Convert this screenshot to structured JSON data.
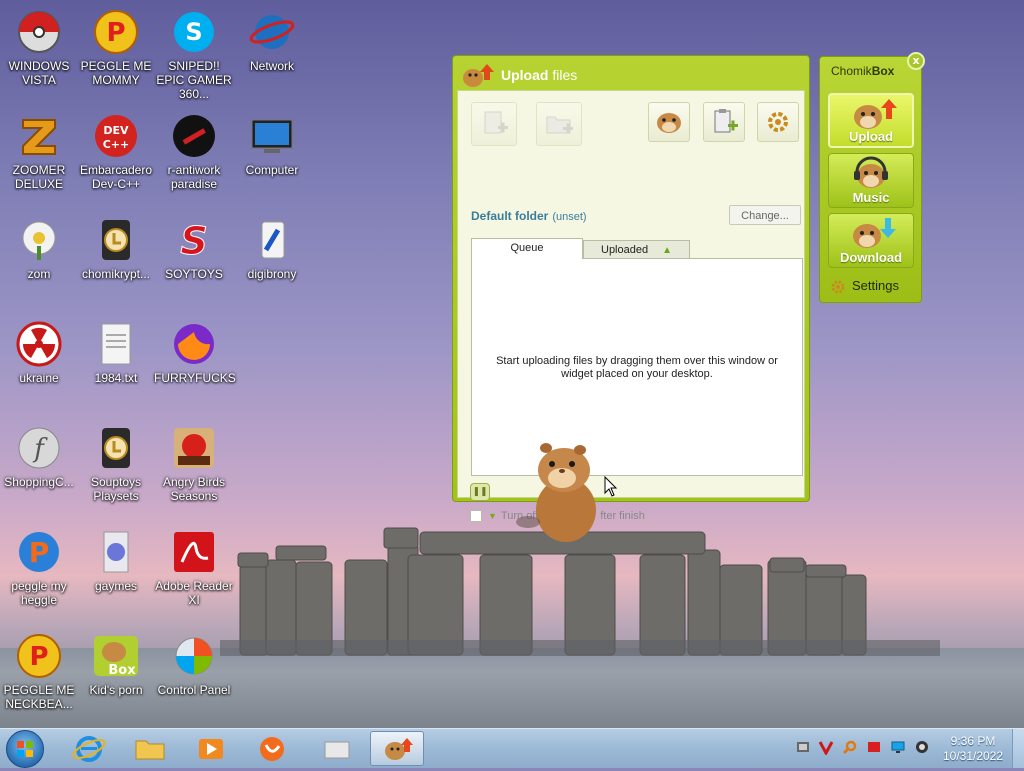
{
  "desktop": {
    "icons": [
      {
        "label": "WINDOWS VISTA",
        "icon": "vista-pokeball-icon"
      },
      {
        "label": "PEGGLE ME MOMMY",
        "icon": "peggle-icon"
      },
      {
        "label": "SNIPED!! EPIC GAMER 360...",
        "icon": "skype-icon"
      },
      {
        "label": "Network",
        "icon": "network-icon"
      },
      {
        "label": "ZOOMER DELUXE",
        "icon": "zoomer-icon"
      },
      {
        "label": "Embarcadero Dev-C++",
        "icon": "devcpp-icon"
      },
      {
        "label": "r-antiwork paradise",
        "icon": "antiwork-icon"
      },
      {
        "label": "Computer",
        "icon": "computer-icon"
      },
      {
        "label": "zom",
        "icon": "zom-icon"
      },
      {
        "label": "chomikrypt...",
        "icon": "chomikrypt-icon"
      },
      {
        "label": "SOYTOYS",
        "icon": "soytoys-icon"
      },
      {
        "label": "digibrony",
        "icon": "digibrony-icon"
      },
      {
        "label": "ukraine",
        "icon": "radiation-icon"
      },
      {
        "label": "1984.txt",
        "icon": "text-file-icon"
      },
      {
        "label": "FURRYFUCKS",
        "icon": "firefox-icon"
      },
      {
        "label": "ShoppingC...",
        "icon": "flash-icon"
      },
      {
        "label": "Souptoys Playsets",
        "icon": "souptoys-icon"
      },
      {
        "label": "Angry Birds Seasons",
        "icon": "angry-birds-icon"
      },
      {
        "label": "peggle my heggle",
        "icon": "peggle-2-icon"
      },
      {
        "label": "gaymes",
        "icon": "games-icon"
      },
      {
        "label": "Adobe Reader XI",
        "icon": "adobe-reader-icon"
      },
      {
        "label": "PEGGLE ME NECKBEA...",
        "icon": "peggle-3-icon"
      },
      {
        "label": "Kid's porn",
        "icon": "chomikbox-icon"
      },
      {
        "label": "Control Panel",
        "icon": "control-panel-icon"
      }
    ]
  },
  "upload_window": {
    "title_bold": "Upload",
    "title_rest": " files",
    "toolbar": {
      "add_files": "add-file-icon",
      "add_folder": "add-folder-icon",
      "hamster": "hamster-icon",
      "paste": "paste-icon",
      "settings": "gear-icon"
    },
    "default_folder_label": "Default folder",
    "default_folder_value": "(unset)",
    "change_button": "Change...",
    "tabs": {
      "queue": "Queue",
      "uploaded": "Uploaded"
    },
    "empty_message": "Start uploading files by dragging them over this window or widget placed on your desktop.",
    "turn_off_label": "Turn off",
    "turn_off_tail": "fter finish"
  },
  "widget": {
    "title_normal": "Chomik",
    "title_bold": "Box",
    "buttons": [
      {
        "label": "Upload",
        "icon": "hamster-upload-icon"
      },
      {
        "label": "Music",
        "icon": "hamster-music-icon"
      },
      {
        "label": "Download",
        "icon": "hamster-download-icon"
      }
    ],
    "settings_label": "Settings",
    "close": "x"
  },
  "taskbar": {
    "clock_time": "9:36 PM",
    "clock_date": "10/31/2022"
  },
  "colors": {
    "chomik_green": "#a2c21c",
    "folder_blue": "#3a7d9b",
    "taskbar": "#9cb9d6"
  }
}
